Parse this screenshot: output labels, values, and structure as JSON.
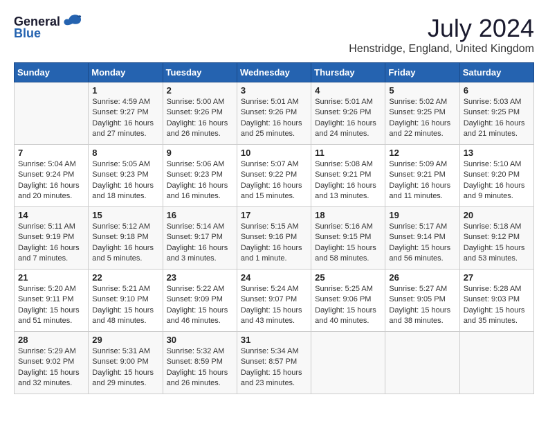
{
  "header": {
    "logo_general": "General",
    "logo_blue": "Blue",
    "month_year": "July 2024",
    "location": "Henstridge, England, United Kingdom"
  },
  "days_of_week": [
    "Sunday",
    "Monday",
    "Tuesday",
    "Wednesday",
    "Thursday",
    "Friday",
    "Saturday"
  ],
  "weeks": [
    [
      {
        "day": "",
        "info": ""
      },
      {
        "day": "1",
        "info": "Sunrise: 4:59 AM\nSunset: 9:27 PM\nDaylight: 16 hours\nand 27 minutes."
      },
      {
        "day": "2",
        "info": "Sunrise: 5:00 AM\nSunset: 9:26 PM\nDaylight: 16 hours\nand 26 minutes."
      },
      {
        "day": "3",
        "info": "Sunrise: 5:01 AM\nSunset: 9:26 PM\nDaylight: 16 hours\nand 25 minutes."
      },
      {
        "day": "4",
        "info": "Sunrise: 5:01 AM\nSunset: 9:26 PM\nDaylight: 16 hours\nand 24 minutes."
      },
      {
        "day": "5",
        "info": "Sunrise: 5:02 AM\nSunset: 9:25 PM\nDaylight: 16 hours\nand 22 minutes."
      },
      {
        "day": "6",
        "info": "Sunrise: 5:03 AM\nSunset: 9:25 PM\nDaylight: 16 hours\nand 21 minutes."
      }
    ],
    [
      {
        "day": "7",
        "info": "Sunrise: 5:04 AM\nSunset: 9:24 PM\nDaylight: 16 hours\nand 20 minutes."
      },
      {
        "day": "8",
        "info": "Sunrise: 5:05 AM\nSunset: 9:23 PM\nDaylight: 16 hours\nand 18 minutes."
      },
      {
        "day": "9",
        "info": "Sunrise: 5:06 AM\nSunset: 9:23 PM\nDaylight: 16 hours\nand 16 minutes."
      },
      {
        "day": "10",
        "info": "Sunrise: 5:07 AM\nSunset: 9:22 PM\nDaylight: 16 hours\nand 15 minutes."
      },
      {
        "day": "11",
        "info": "Sunrise: 5:08 AM\nSunset: 9:21 PM\nDaylight: 16 hours\nand 13 minutes."
      },
      {
        "day": "12",
        "info": "Sunrise: 5:09 AM\nSunset: 9:21 PM\nDaylight: 16 hours\nand 11 minutes."
      },
      {
        "day": "13",
        "info": "Sunrise: 5:10 AM\nSunset: 9:20 PM\nDaylight: 16 hours\nand 9 minutes."
      }
    ],
    [
      {
        "day": "14",
        "info": "Sunrise: 5:11 AM\nSunset: 9:19 PM\nDaylight: 16 hours\nand 7 minutes."
      },
      {
        "day": "15",
        "info": "Sunrise: 5:12 AM\nSunset: 9:18 PM\nDaylight: 16 hours\nand 5 minutes."
      },
      {
        "day": "16",
        "info": "Sunrise: 5:14 AM\nSunset: 9:17 PM\nDaylight: 16 hours\nand 3 minutes."
      },
      {
        "day": "17",
        "info": "Sunrise: 5:15 AM\nSunset: 9:16 PM\nDaylight: 16 hours\nand 1 minute."
      },
      {
        "day": "18",
        "info": "Sunrise: 5:16 AM\nSunset: 9:15 PM\nDaylight: 15 hours\nand 58 minutes."
      },
      {
        "day": "19",
        "info": "Sunrise: 5:17 AM\nSunset: 9:14 PM\nDaylight: 15 hours\nand 56 minutes."
      },
      {
        "day": "20",
        "info": "Sunrise: 5:18 AM\nSunset: 9:12 PM\nDaylight: 15 hours\nand 53 minutes."
      }
    ],
    [
      {
        "day": "21",
        "info": "Sunrise: 5:20 AM\nSunset: 9:11 PM\nDaylight: 15 hours\nand 51 minutes."
      },
      {
        "day": "22",
        "info": "Sunrise: 5:21 AM\nSunset: 9:10 PM\nDaylight: 15 hours\nand 48 minutes."
      },
      {
        "day": "23",
        "info": "Sunrise: 5:22 AM\nSunset: 9:09 PM\nDaylight: 15 hours\nand 46 minutes."
      },
      {
        "day": "24",
        "info": "Sunrise: 5:24 AM\nSunset: 9:07 PM\nDaylight: 15 hours\nand 43 minutes."
      },
      {
        "day": "25",
        "info": "Sunrise: 5:25 AM\nSunset: 9:06 PM\nDaylight: 15 hours\nand 40 minutes."
      },
      {
        "day": "26",
        "info": "Sunrise: 5:27 AM\nSunset: 9:05 PM\nDaylight: 15 hours\nand 38 minutes."
      },
      {
        "day": "27",
        "info": "Sunrise: 5:28 AM\nSunset: 9:03 PM\nDaylight: 15 hours\nand 35 minutes."
      }
    ],
    [
      {
        "day": "28",
        "info": "Sunrise: 5:29 AM\nSunset: 9:02 PM\nDaylight: 15 hours\nand 32 minutes."
      },
      {
        "day": "29",
        "info": "Sunrise: 5:31 AM\nSunset: 9:00 PM\nDaylight: 15 hours\nand 29 minutes."
      },
      {
        "day": "30",
        "info": "Sunrise: 5:32 AM\nSunset: 8:59 PM\nDaylight: 15 hours\nand 26 minutes."
      },
      {
        "day": "31",
        "info": "Sunrise: 5:34 AM\nSunset: 8:57 PM\nDaylight: 15 hours\nand 23 minutes."
      },
      {
        "day": "",
        "info": ""
      },
      {
        "day": "",
        "info": ""
      },
      {
        "day": "",
        "info": ""
      }
    ]
  ]
}
